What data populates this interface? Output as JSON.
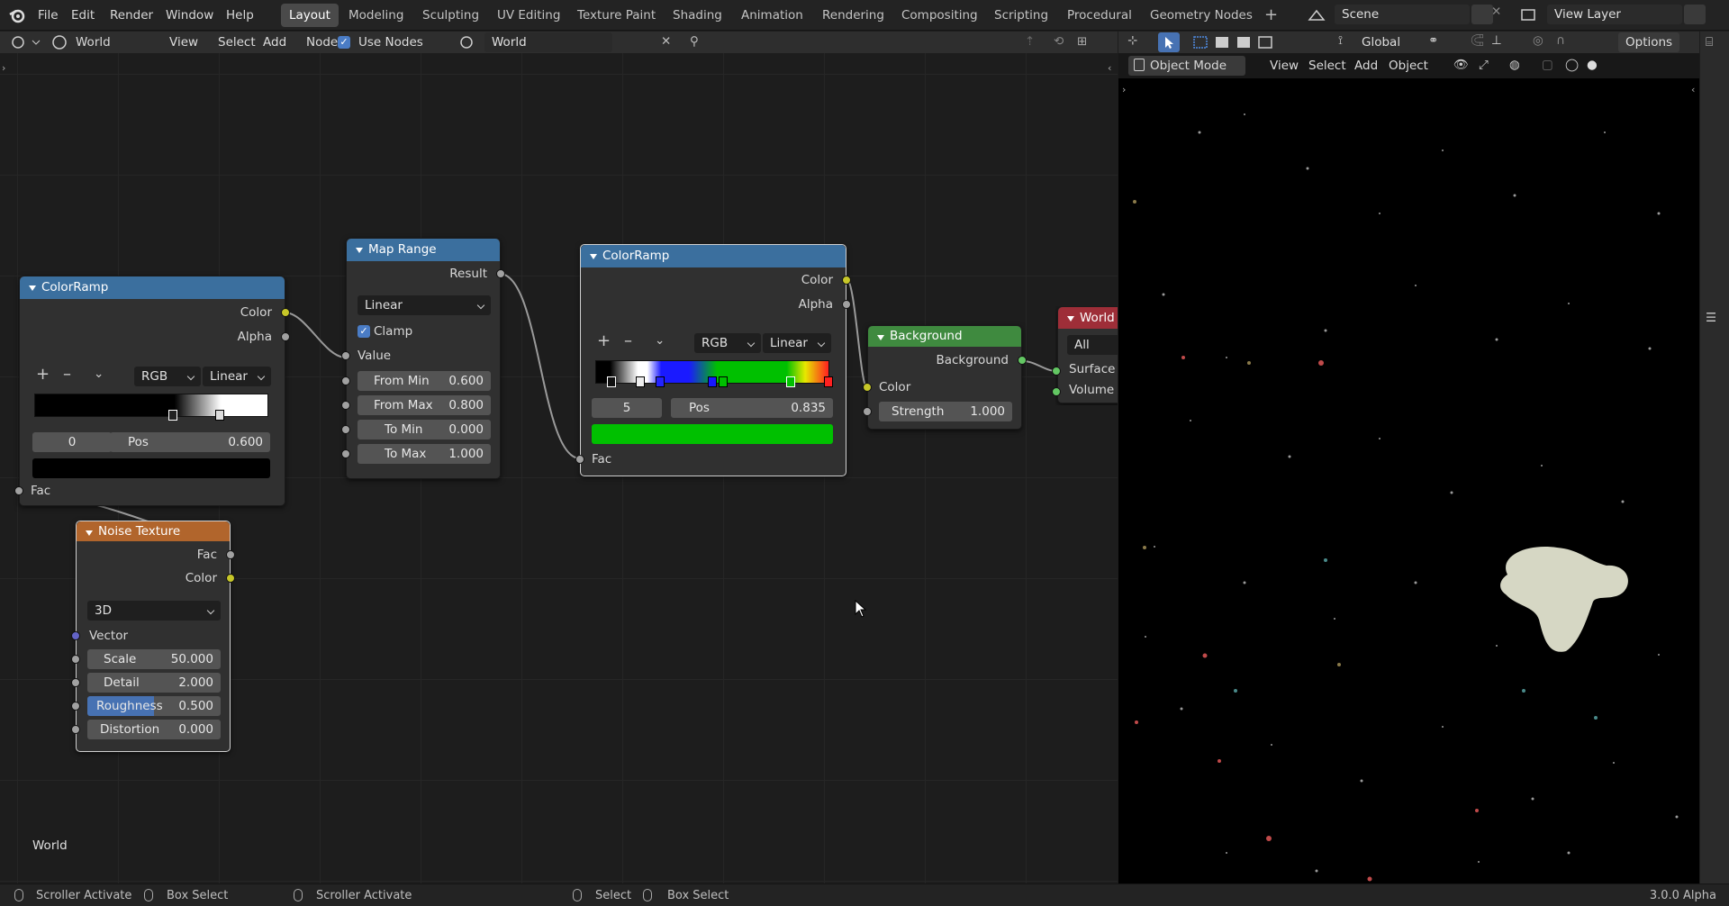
{
  "menu": [
    "File",
    "Edit",
    "Render",
    "Window",
    "Help"
  ],
  "workspaces": [
    "Layout",
    "Modeling",
    "Sculpting",
    "UV Editing",
    "Texture Paint",
    "Shading",
    "Animation",
    "Rendering",
    "Compositing",
    "Scripting",
    "Procedural",
    "Geometry Nodes"
  ],
  "scene": "Scene",
  "view_layer": "View Layer",
  "node_header": {
    "editor_type": "World",
    "view": "View",
    "select": "Select",
    "add": "Add",
    "node": "Node",
    "use_nodes": "Use Nodes",
    "world_name": "World"
  },
  "viewport_header": {
    "transform": "Global",
    "options": "Options",
    "mode": "Object Mode",
    "view": "View",
    "select": "Select",
    "add": "Add",
    "object": "Object"
  },
  "editor_label": "World",
  "nodes": {
    "ramp1": {
      "title": "ColorRamp",
      "out_color": "Color",
      "out_alpha": "Alpha",
      "mode": "RGB",
      "interp": "Linear",
      "index": "0",
      "pos_label": "Pos",
      "pos": "0.600",
      "fac": "Fac"
    },
    "maprange": {
      "title": "Map Range",
      "result": "Result",
      "interp": "Linear",
      "clamp": "Clamp",
      "value": "Value",
      "from_min_l": "From Min",
      "from_min": "0.600",
      "from_max_l": "From Max",
      "from_max": "0.800",
      "to_min_l": "To Min",
      "to_min": "0.000",
      "to_max_l": "To Max",
      "to_max": "1.000"
    },
    "ramp2": {
      "title": "ColorRamp",
      "out_color": "Color",
      "out_alpha": "Alpha",
      "mode": "RGB",
      "interp": "Linear",
      "index": "5",
      "pos_label": "Pos",
      "pos": "0.835",
      "fac": "Fac"
    },
    "background": {
      "title": "Background",
      "out": "Background",
      "color": "Color",
      "strength_l": "Strength",
      "strength": "1.000"
    },
    "world": {
      "title": "World",
      "target": "All",
      "surface": "Surface",
      "volume": "Volume"
    },
    "noise": {
      "title": "Noise Texture",
      "fac": "Fac",
      "color": "Color",
      "dims": "3D",
      "vector": "Vector",
      "scale_l": "Scale",
      "scale": "50.000",
      "detail_l": "Detail",
      "detail": "2.000",
      "rough_l": "Roughness",
      "rough": "0.500",
      "dist_l": "Distortion",
      "dist": "0.000"
    }
  },
  "status": {
    "s1": "Scroller Activate",
    "s2": "Box Select",
    "s3": "Scroller Activate",
    "s4": "Select",
    "s5": "Box Select",
    "version": "3.0.0 Alpha"
  },
  "colors": {
    "ramp_header": "#3b6f9e",
    "map_header": "#3b6f9e",
    "bg_header": "#3f8a3f",
    "world_header": "#9e2e38",
    "noise_header": "#b1652c",
    "ramp2_selected": "#00c000"
  }
}
